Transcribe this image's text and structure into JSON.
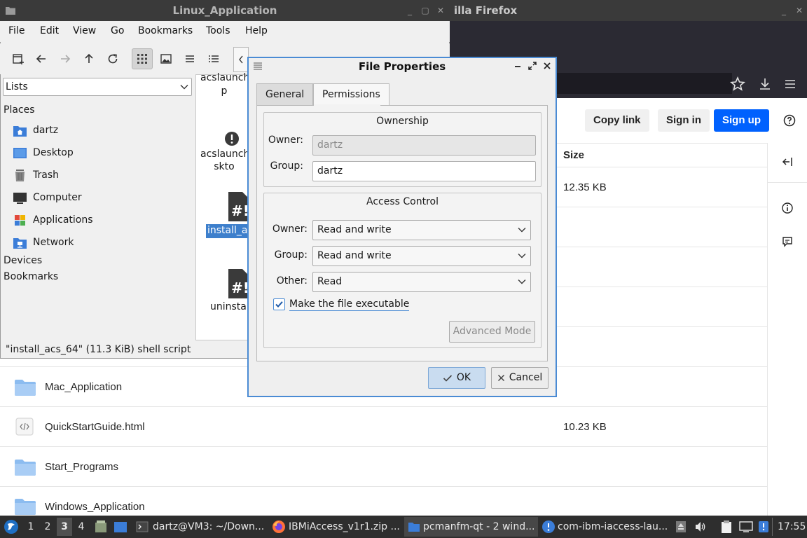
{
  "firefox": {
    "title": "illa Firefox",
    "header_buttons": {
      "copy_link": "Copy link",
      "sign_in": "Sign in",
      "sign_up": "Sign up"
    },
    "column_size": "Size",
    "rows": [
      {
        "name": "",
        "size": "12.35 KB",
        "icon": "file-icon"
      },
      {
        "name": "Mac_Application",
        "size": "",
        "icon": "folder-icon"
      },
      {
        "name": "QuickStartGuide.html",
        "size": "10.23 KB",
        "icon": "code-file-icon"
      },
      {
        "name": "Start_Programs",
        "size": "",
        "icon": "folder-icon"
      },
      {
        "name": "Windows_Application",
        "size": "",
        "icon": "folder-icon"
      }
    ]
  },
  "file_manager": {
    "title": "Linux_Application",
    "menu": [
      "File",
      "Edit",
      "View",
      "Go",
      "Bookmarks",
      "Tools",
      "Help"
    ],
    "side_select": "Lists",
    "places_header": "Places",
    "places": [
      {
        "label": "dartz",
        "icon": "home-folder-icon",
        "color": "#3b7dd8"
      },
      {
        "label": "Desktop",
        "icon": "desktop-icon",
        "color": "#3b7dd8"
      },
      {
        "label": "Trash",
        "icon": "trash-icon",
        "color": "#6d6d6d"
      },
      {
        "label": "Computer",
        "icon": "computer-icon",
        "color": "#333333"
      },
      {
        "label": "Applications",
        "icon": "applications-icon",
        "color": "#e2493b"
      },
      {
        "label": "Network",
        "icon": "network-icon",
        "color": "#3b7dd8"
      }
    ],
    "devices_header": "Devices",
    "bookmarks_header": "Bookmarks",
    "files": [
      {
        "label": "acslaunch_\np",
        "icon": "text-file-icon"
      },
      {
        "label": "acslaunch_\nskto",
        "icon": "warning-icon"
      },
      {
        "label": "install_a",
        "icon": "script-file-icon",
        "selected": true
      },
      {
        "label": "uninstal",
        "icon": "script-file-icon"
      }
    ],
    "status": "\"install_acs_64\" (11.3 KiB) shell script"
  },
  "dialog": {
    "title": "File Properties",
    "tabs": {
      "general": "General",
      "permissions": "Permissions"
    },
    "ownership": {
      "title": "Ownership",
      "owner_label": "Owner:",
      "owner_value": "dartz",
      "group_label": "Group:",
      "group_value": "dartz"
    },
    "access": {
      "title": "Access Control",
      "owner_label": "Owner:",
      "owner_value": "Read and write",
      "group_label": "Group:",
      "group_value": "Read and write",
      "other_label": "Other:",
      "other_value": "Read",
      "executable_label": "Make the file executable",
      "executable_checked": true,
      "advanced_button": "Advanced Mode"
    },
    "ok_button": "OK",
    "cancel_button": "Cancel"
  },
  "taskbar": {
    "desktops": [
      "1",
      "2",
      "3",
      "4"
    ],
    "active_desktop": "3",
    "tasks": [
      {
        "label": "dartz@VM3: ~/Down...",
        "icon": "terminal-icon"
      },
      {
        "label": "IBMiAccess_v1r1.zip ...",
        "icon": "firefox-icon"
      },
      {
        "label": "pcmanfm-qt - 2 wind...",
        "icon": "folder-icon",
        "active": true
      },
      {
        "label": "com-ibm-iaccess-lau...",
        "icon": "java-app-icon"
      }
    ],
    "clock": "17:55"
  },
  "colors": {
    "accent": "#4a8bd4",
    "sign_up": "#0061fe",
    "selection": "#3d7fcc"
  }
}
